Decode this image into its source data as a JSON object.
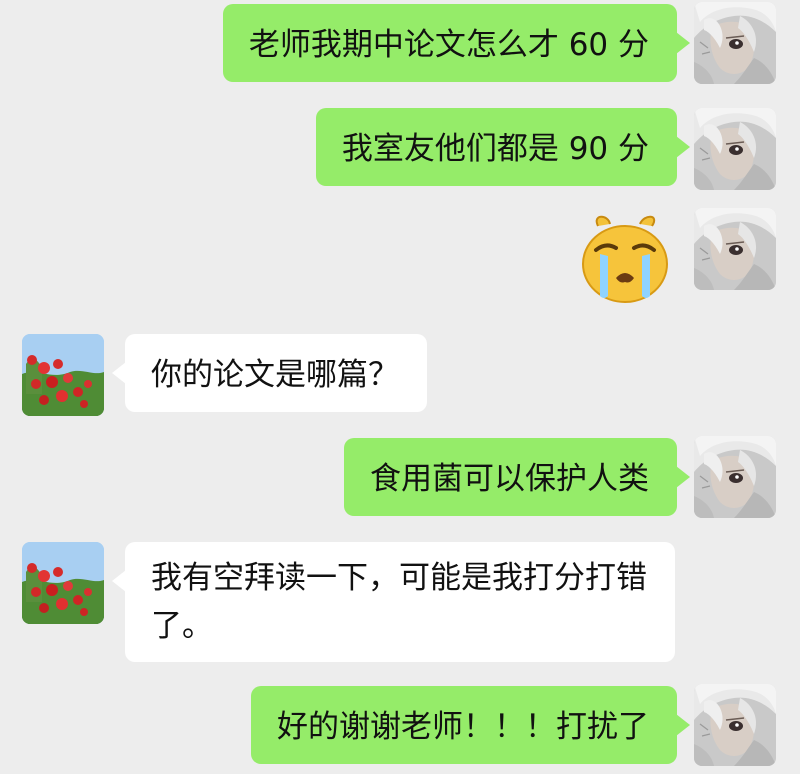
{
  "messages": [
    {
      "sender": "me",
      "text": "老师我期中论文怎么才 60 分"
    },
    {
      "sender": "me",
      "text": "我室友他们都是 90 分"
    },
    {
      "sender": "me",
      "emoji": "crying-face-emoji"
    },
    {
      "sender": "teacher",
      "text": "你的论文是哪篇？"
    },
    {
      "sender": "me",
      "text": "食用菌可以保护人类"
    },
    {
      "sender": "teacher",
      "text": "我有空拜读一下，可能是我打分打错了。"
    },
    {
      "sender": "me",
      "text": "好的谢谢老师！！！打扰了"
    }
  ],
  "avatars": {
    "me": "anime-character-avatar",
    "teacher": "red-flowers-avatar"
  },
  "colors": {
    "background": "#ededed",
    "my_bubble": "#95ec69",
    "their_bubble": "#ffffff"
  }
}
